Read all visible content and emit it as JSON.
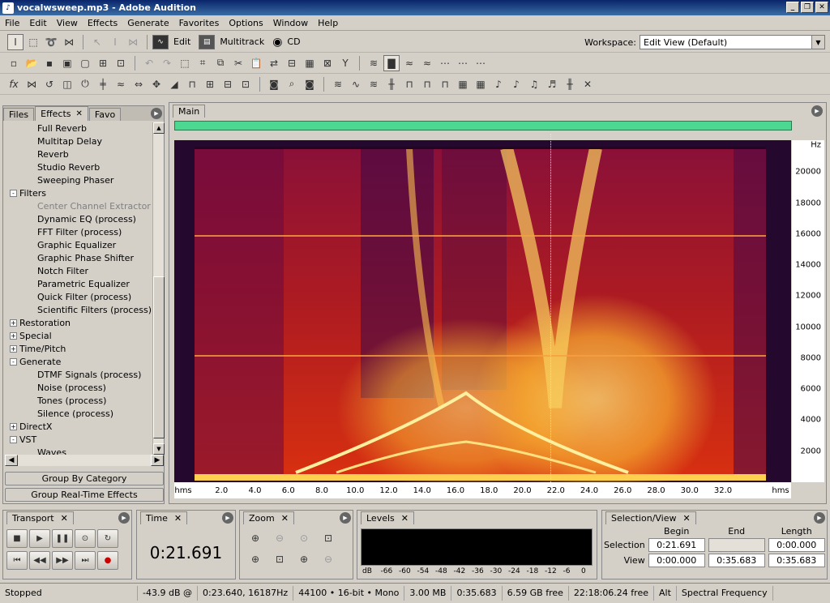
{
  "window": {
    "title": "vocalwsweep.mp3 - Adobe Audition",
    "icon": "audition-icon"
  },
  "menu": [
    "File",
    "Edit",
    "View",
    "Effects",
    "Generate",
    "Favorites",
    "Options",
    "Window",
    "Help"
  ],
  "modes": {
    "edit": "Edit",
    "multitrack": "Multitrack",
    "cd": "CD"
  },
  "workspace": {
    "label": "Workspace:",
    "value": "Edit View (Default)"
  },
  "left_panel": {
    "tabs": [
      "Files",
      "Effects",
      "Favo"
    ],
    "tree": [
      {
        "label": "Full Reverb",
        "level": 1
      },
      {
        "label": "Multitap Delay",
        "level": 1
      },
      {
        "label": "Reverb",
        "level": 1
      },
      {
        "label": "Studio Reverb",
        "level": 1
      },
      {
        "label": "Sweeping Phaser",
        "level": 1
      },
      {
        "label": "Filters",
        "level": 0,
        "expander": "⊟"
      },
      {
        "label": "Center Channel Extractor",
        "level": 1,
        "disabled": true
      },
      {
        "label": "Dynamic EQ (process)",
        "level": 1
      },
      {
        "label": "FFT Filter (process)",
        "level": 1
      },
      {
        "label": "Graphic Equalizer",
        "level": 1
      },
      {
        "label": "Graphic Phase Shifter",
        "level": 1
      },
      {
        "label": "Notch Filter",
        "level": 1
      },
      {
        "label": "Parametric Equalizer",
        "level": 1
      },
      {
        "label": "Quick Filter (process)",
        "level": 1
      },
      {
        "label": "Scientific Filters (process)",
        "level": 1
      },
      {
        "label": "Restoration",
        "level": 0,
        "expander": "⊞"
      },
      {
        "label": "Special",
        "level": 0,
        "expander": "⊞"
      },
      {
        "label": "Time/Pitch",
        "level": 0,
        "expander": "⊞"
      },
      {
        "label": "Generate",
        "level": 0,
        "expander": "⊟"
      },
      {
        "label": "DTMF Signals (process)",
        "level": 1
      },
      {
        "label": "Noise (process)",
        "level": 1
      },
      {
        "label": "Tones (process)",
        "level": 1
      },
      {
        "label": "Silence (process)",
        "level": 1
      },
      {
        "label": "DirectX",
        "level": 0,
        "expander": "⊞"
      },
      {
        "label": "VST",
        "level": 0,
        "expander": "⊟"
      },
      {
        "label": "Waves",
        "level": 1
      }
    ],
    "group_by_category": "Group By Category",
    "group_realtime": "Group Real-Time Effects"
  },
  "main": {
    "tab": "Main",
    "freq_unit": "Hz",
    "freq_ticks": [
      "20000",
      "18000",
      "16000",
      "14000",
      "12000",
      "10000",
      "8000",
      "6000",
      "4000",
      "2000"
    ],
    "time_unit": "hms",
    "time_ticks": [
      "2.0",
      "4.0",
      "6.0",
      "8.0",
      "10.0",
      "12.0",
      "14.0",
      "16.0",
      "18.0",
      "20.0",
      "22.0",
      "24.0",
      "26.0",
      "28.0",
      "30.0",
      "32.0"
    ],
    "colors": {
      "overview": "#4cd890",
      "cursor": "#ffff00"
    }
  },
  "transport": {
    "title": "Transport"
  },
  "time_panel": {
    "title": "Time",
    "value": "0:21.691"
  },
  "zoom": {
    "title": "Zoom"
  },
  "levels": {
    "title": "Levels",
    "scale": [
      "dB",
      "-66",
      "-60",
      "-54",
      "-48",
      "-42",
      "-36",
      "-30",
      "-24",
      "-18",
      "-12",
      "-6",
      "0"
    ]
  },
  "selection_view": {
    "title": "Selection/View",
    "headers": [
      "Begin",
      "End",
      "Length"
    ],
    "selection_label": "Selection",
    "view_label": "View",
    "selection": [
      "0:21.691",
      "",
      "0:00.000"
    ],
    "view": [
      "0:00.000",
      "0:35.683",
      "0:35.683"
    ]
  },
  "status": [
    "Stopped",
    "-43.9 dB @",
    "0:23.640, 16187Hz",
    "44100 • 16-bit • Mono",
    "3.00 MB",
    "0:35.683",
    "6.59 GB free",
    "22:18:06.24 free",
    "Alt",
    "Spectral Frequency"
  ]
}
